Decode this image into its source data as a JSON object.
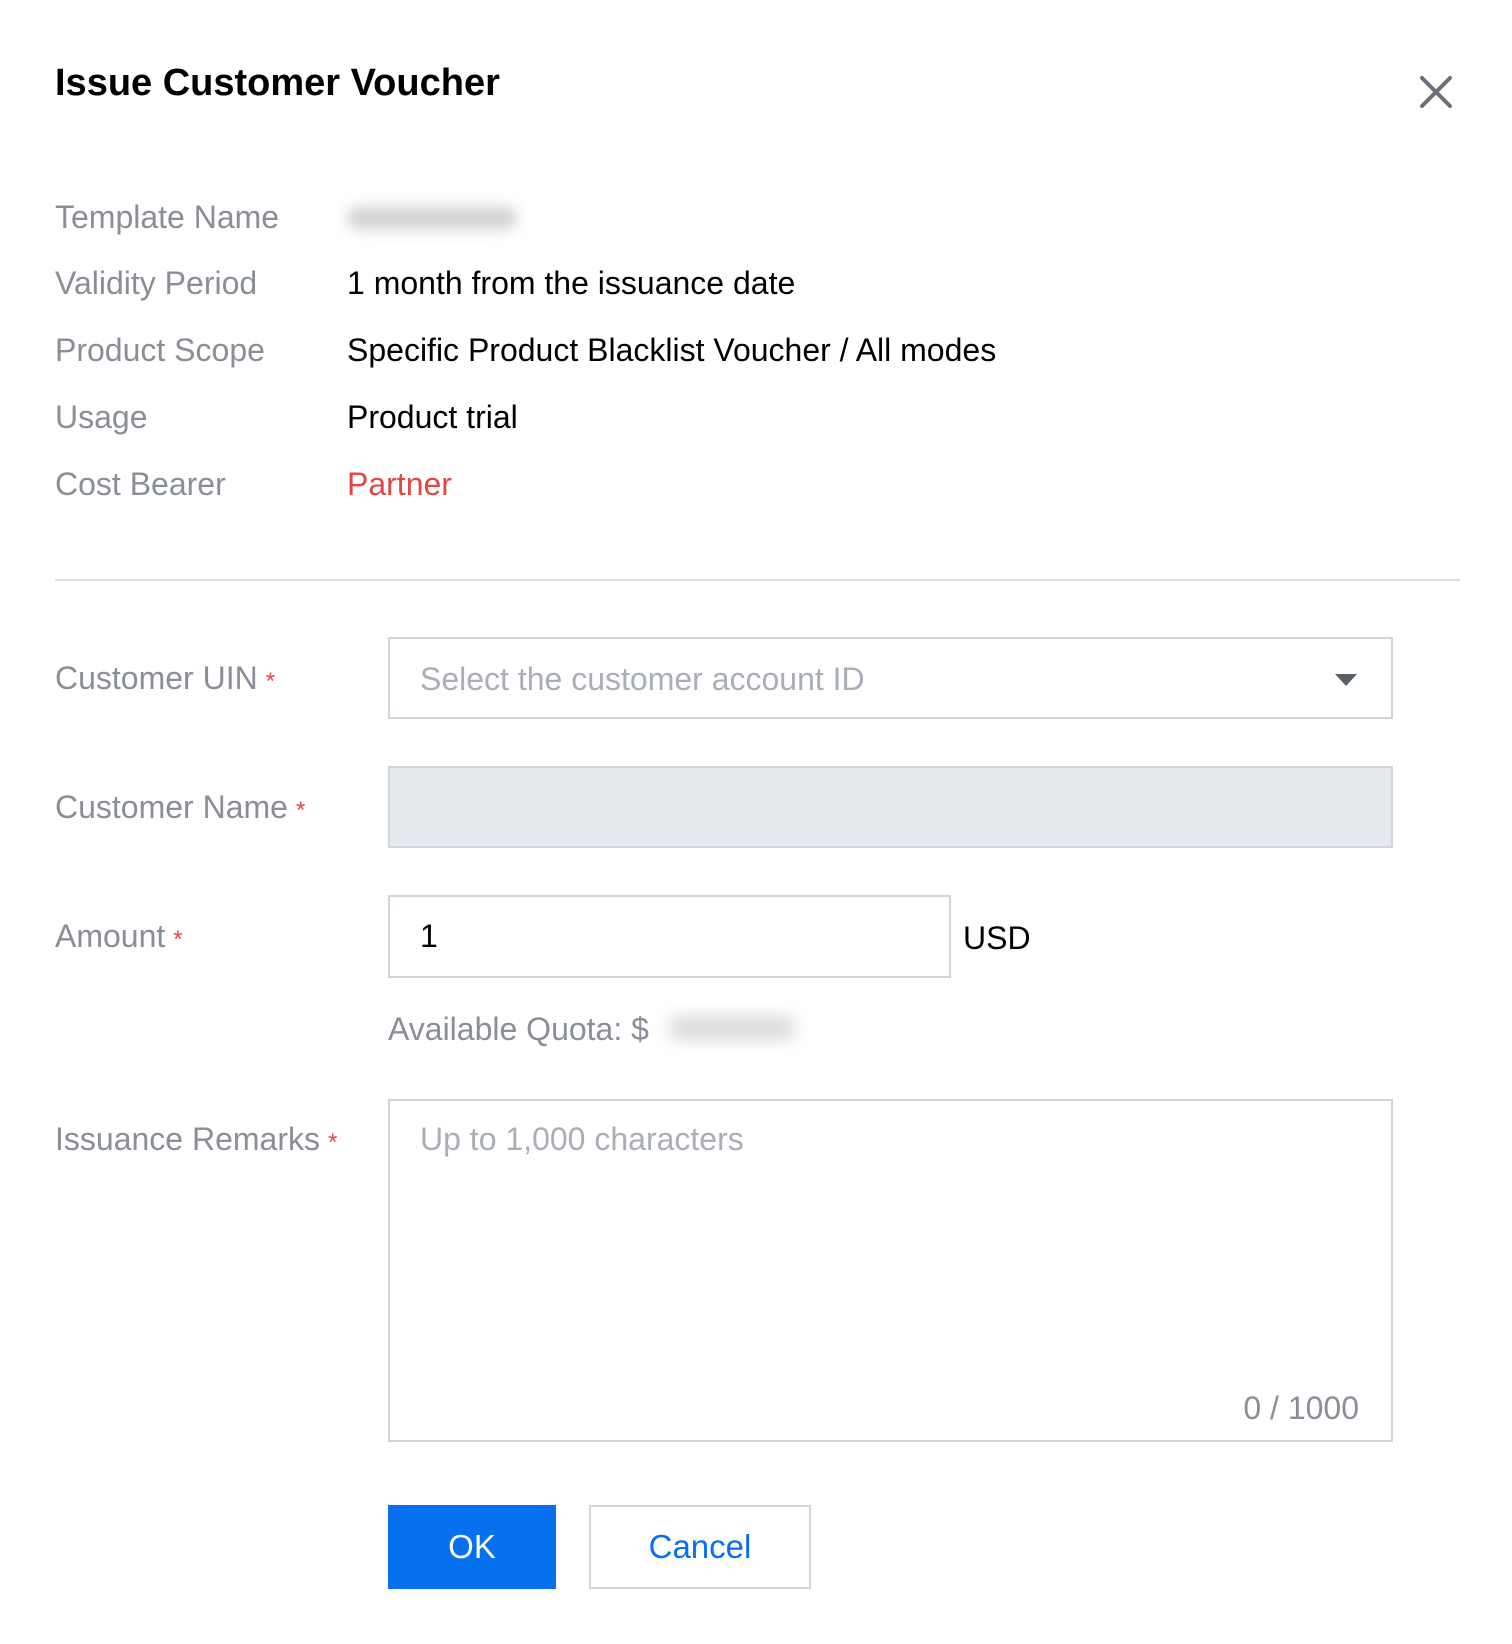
{
  "dialog": {
    "title": "Issue Customer Voucher",
    "close_icon": "close-icon"
  },
  "info": {
    "template_name_label": "Template Name",
    "validity_period_label": "Validity Period",
    "validity_period_value": "1 month from the issuance date",
    "product_scope_label": "Product Scope",
    "product_scope_value": "Specific Product Blacklist Voucher / All modes",
    "usage_label": "Usage",
    "usage_value": "Product trial",
    "cost_bearer_label": "Cost Bearer",
    "cost_bearer_value": "Partner",
    "cost_bearer_color": "#e54545"
  },
  "form": {
    "required_mark": "*",
    "customer_uin_label": "Customer UIN",
    "customer_uin_placeholder": "Select the customer account ID",
    "customer_name_label": "Customer Name",
    "amount_label": "Amount",
    "amount_value": "1",
    "amount_unit": "USD",
    "available_quota_label": "Available Quota: $",
    "remarks_label": "Issuance Remarks",
    "remarks_placeholder": "Up to 1,000 characters",
    "remarks_counter": "0 / 1000"
  },
  "actions": {
    "ok_label": "OK",
    "cancel_label": "Cancel",
    "primary_color": "#0770ef"
  }
}
